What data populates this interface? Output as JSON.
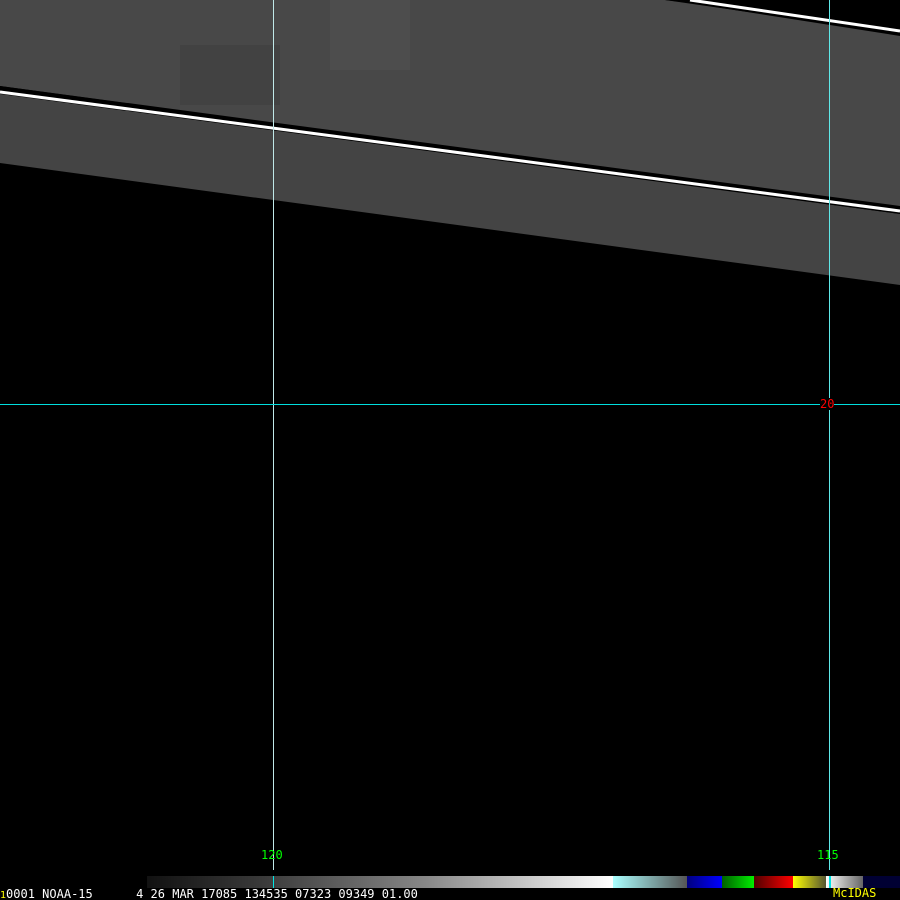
{
  "image": {
    "satellite": "NOAA-15",
    "frame": "0001",
    "frame_marker": "1",
    "status_text": "4 26 MAR 17085 134535 07323 09349 01.00",
    "brand": "McIDAS"
  },
  "grid_labels": {
    "lon_120": "120",
    "lon_115": "115",
    "lat_20": "20"
  },
  "colors": {
    "swath": "#474747",
    "grid": "#5fe8e8",
    "lon_label": "#00ff00",
    "lat_label": "#ff0000",
    "brand": "#ffff00"
  }
}
